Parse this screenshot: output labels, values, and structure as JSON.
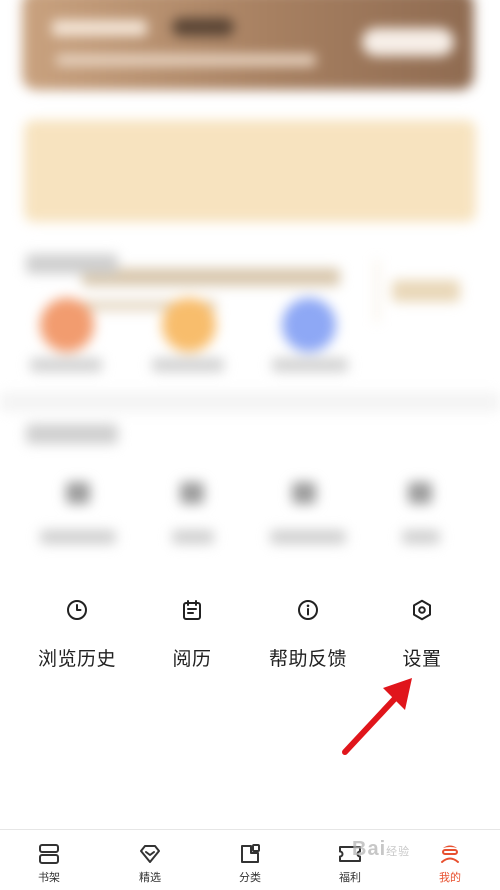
{
  "tools": [
    {
      "label": "浏览历史",
      "icon": "clock-icon"
    },
    {
      "label": "阅历",
      "icon": "calendar-icon"
    },
    {
      "label": "帮助反馈",
      "icon": "info-icon"
    },
    {
      "label": "设置",
      "icon": "settings-icon"
    }
  ],
  "bottom_nav": [
    {
      "label": "书架",
      "icon": "bookshelf-icon",
      "active": false
    },
    {
      "label": "精选",
      "icon": "diamond-icon",
      "active": false
    },
    {
      "label": "分类",
      "icon": "category-icon",
      "active": false
    },
    {
      "label": "福利",
      "icon": "ticket-icon",
      "active": false
    },
    {
      "label": "我的",
      "icon": "profile-icon",
      "active": true
    }
  ],
  "watermark": {
    "text": "Bai",
    "sub": "经验"
  },
  "colors": {
    "accent": "#e8502f",
    "arrow": "#e0151b"
  }
}
